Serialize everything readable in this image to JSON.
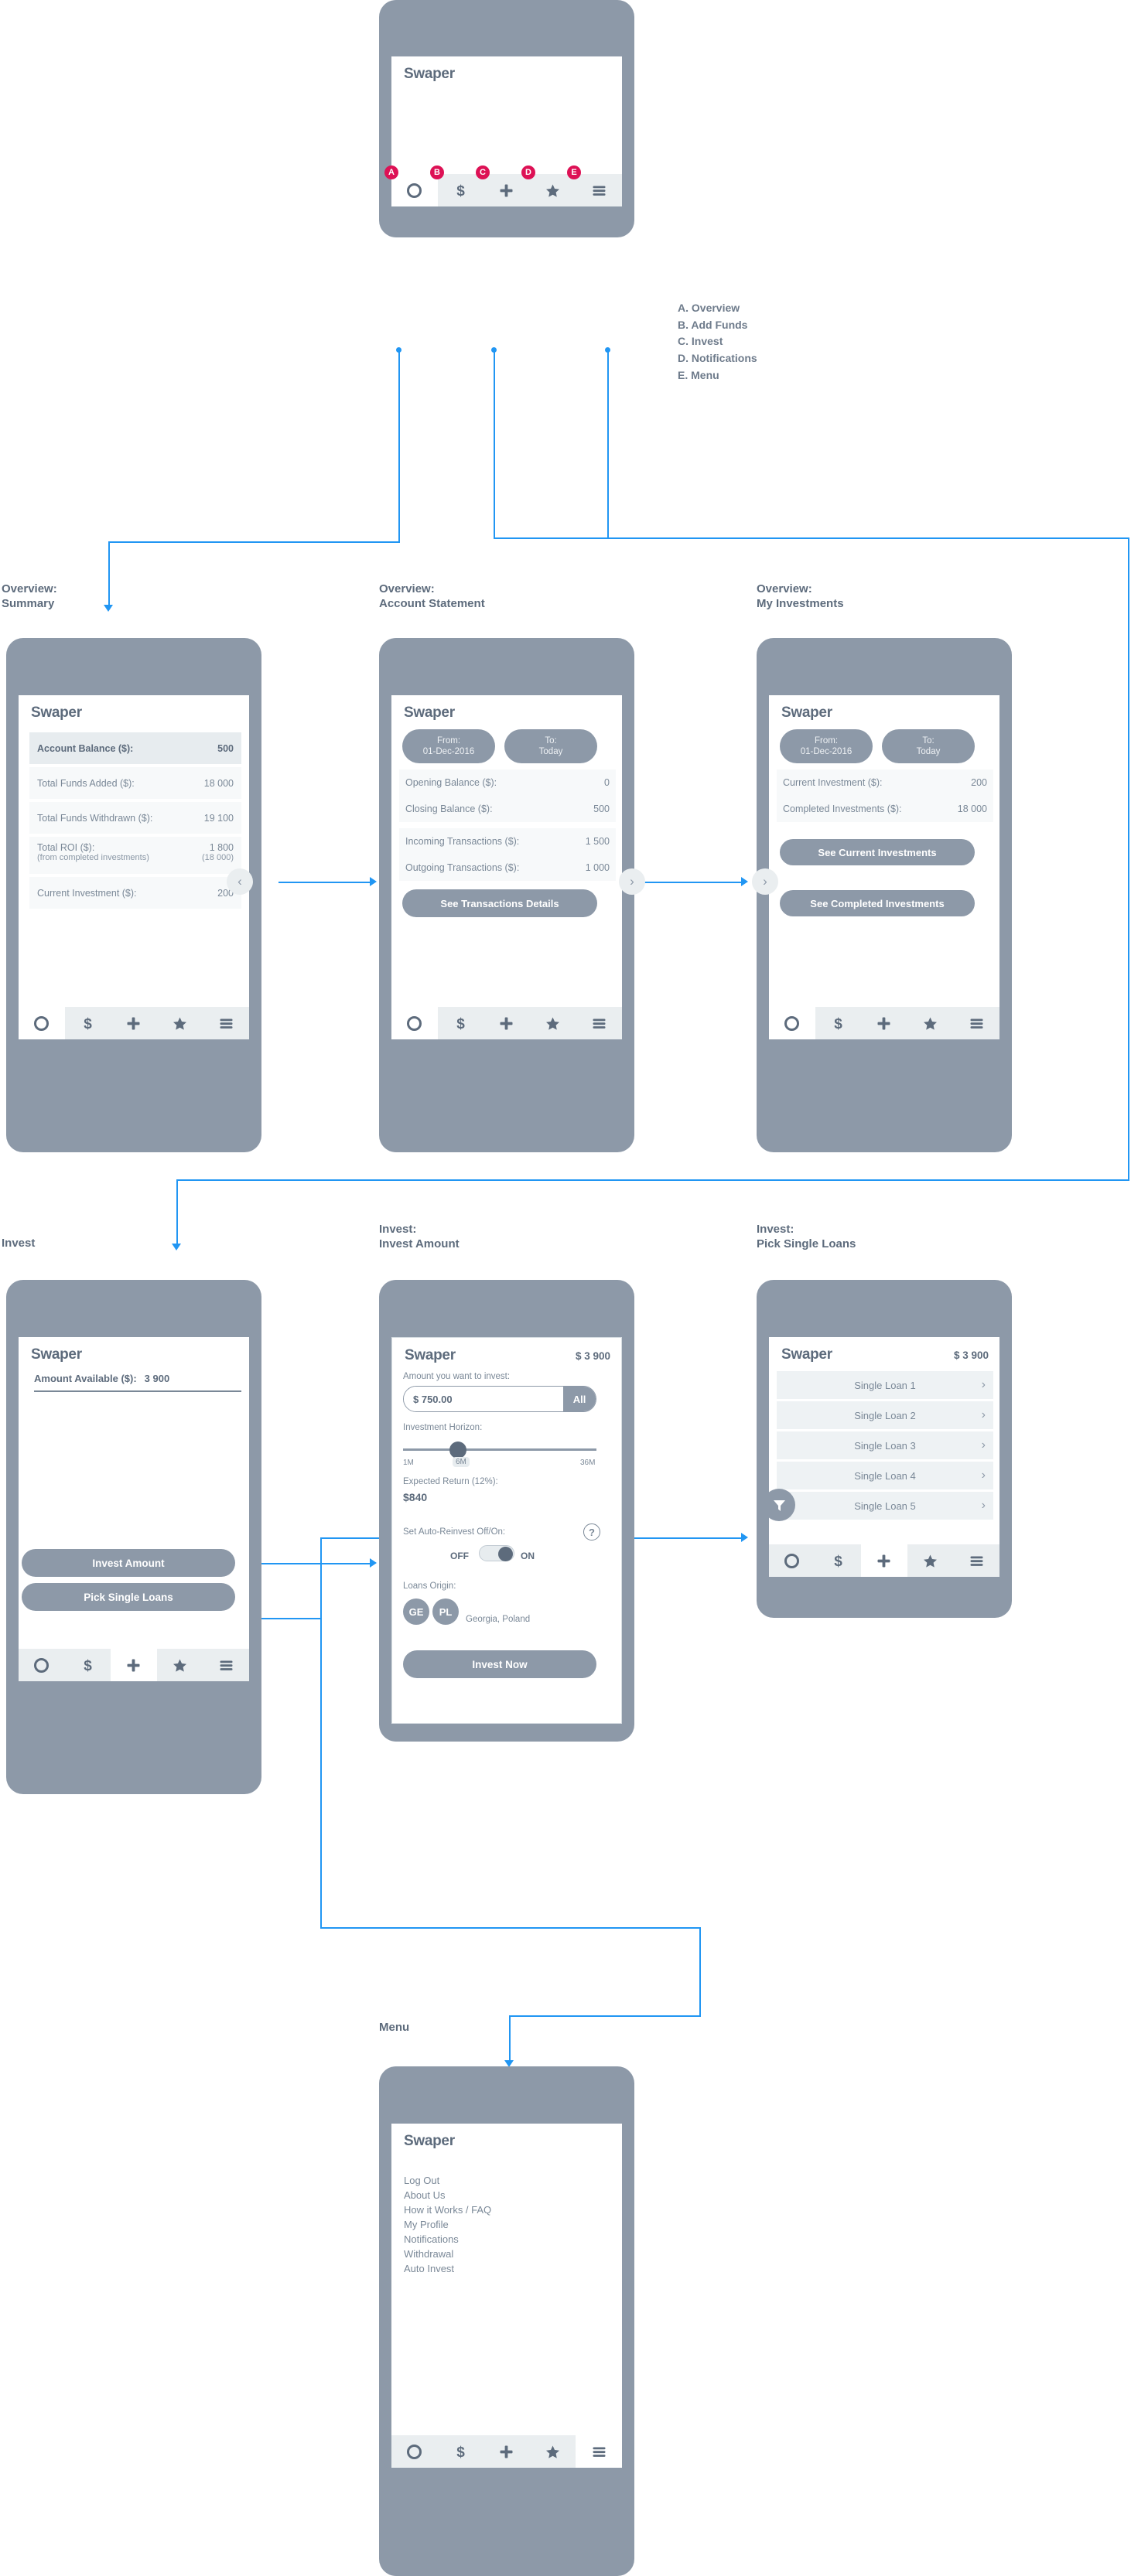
{
  "app": {
    "brand": "Swaper"
  },
  "legend": {
    "items": [
      "A. Overview",
      "B. Add Funds",
      "C. Invest",
      "D. Notifications",
      "E. Menu"
    ]
  },
  "nav": {
    "badges": [
      "A",
      "B",
      "C",
      "D",
      "E"
    ],
    "icons": [
      "overview-circle-icon",
      "dollar-icon",
      "plus-icon",
      "star-icon",
      "hamburger-icon"
    ]
  },
  "flow_labels": {
    "overview_summary": {
      "line1": "Overview:",
      "line2": "Summary"
    },
    "overview_statement": {
      "line1": "Overview:",
      "line2": "Account Statement"
    },
    "overview_investments": {
      "line1": "Overview:",
      "line2": "My Investments"
    },
    "invest": {
      "line1": "Invest",
      "line2": ""
    },
    "invest_amount": {
      "line1": "Invest:",
      "line2": "Invest Amount"
    },
    "invest_pick": {
      "line1": "Invest:",
      "line2": "Pick Single Loans"
    },
    "menu": {
      "line1": "Menu",
      "line2": ""
    }
  },
  "screens": {
    "summary": {
      "rows": [
        {
          "label": "Account Balance ($):",
          "value": "500",
          "highlight": true
        },
        {
          "label": "Total Funds Added ($):",
          "value": "18 000",
          "highlight": false
        },
        {
          "label": "Total Funds Withdrawn ($):",
          "value": "19 100",
          "highlight": false
        },
        {
          "label": "Total ROI ($):",
          "value": "1 800",
          "sub_label": "(from completed investments)",
          "sub_value": "(18 000)",
          "highlight": false
        },
        {
          "label": "Current Investment ($):",
          "value": "200",
          "highlight": false
        }
      ]
    },
    "statement": {
      "from": {
        "caption": "From:",
        "value": "01-Dec-2016"
      },
      "to": {
        "caption": "To:",
        "value": "Today"
      },
      "rows": [
        {
          "label": "Opening Balance ($):",
          "value": "0"
        },
        {
          "label": "Closing Balance ($):",
          "value": "500"
        },
        {
          "label": "Incoming Transactions ($):",
          "value": "1 500"
        },
        {
          "label": "Outgoing Transactions ($):",
          "value": "1 000"
        }
      ],
      "button": "See Transactions Details"
    },
    "investments": {
      "from": {
        "caption": "From:",
        "value": "01-Dec-2016"
      },
      "to": {
        "caption": "To:",
        "value": "Today"
      },
      "rows": [
        {
          "label": "Current Investment ($):",
          "value": "200"
        },
        {
          "label": "Completed Investments ($):",
          "value": "18 000"
        }
      ],
      "buttons": [
        "See Current Investments",
        "See Completed Investments"
      ]
    },
    "invest_home": {
      "amount_label": "Amount Available ($):",
      "amount_value": "3 900",
      "buttons": [
        "Invest Amount",
        "Pick Single Loans"
      ]
    },
    "invest_amount": {
      "header_balance": "$ 3 900",
      "amount_caption": "Amount you want to invest:",
      "amount_value": "$ 750.00",
      "all_button": "All",
      "horizon_caption": "Investment Horizon:",
      "horizon_min": "1M",
      "horizon_current": "6M",
      "horizon_max": "36M",
      "return_caption": "Expected Return (12%):",
      "return_value": "$840",
      "reinvest_caption": "Set Auto-Reinvest Off/On:",
      "toggle_off": "OFF",
      "toggle_on": "ON",
      "help_icon": "?",
      "origin_caption": "Loans Origin:",
      "origin_codes": [
        "GE",
        "PL"
      ],
      "origin_names": "Georgia, Poland",
      "submit_button": "Invest Now"
    },
    "pick_loans": {
      "header_balance": "$ 3 900",
      "loans": [
        "Single Loan 1",
        "Single Loan 2",
        "Single Loan 3",
        "Single Loan 4",
        "Single Loan 5"
      ],
      "filter_icon": "filter-funnel-icon"
    },
    "menu": {
      "items": [
        "Log Out",
        "About Us",
        "How it Works / FAQ",
        "My Profile",
        "Notifications",
        "Withdrawal",
        "Auto Invest"
      ]
    }
  },
  "colors": {
    "frame": "#8d99a8",
    "text": "#5d6b7c",
    "muted": "#7a8897",
    "badge": "#dd1155",
    "connector": "#2196f3",
    "row_bg": "#f7f9fa",
    "row_hl": "#e7ecef",
    "nav_bg": "#eaeef0"
  }
}
